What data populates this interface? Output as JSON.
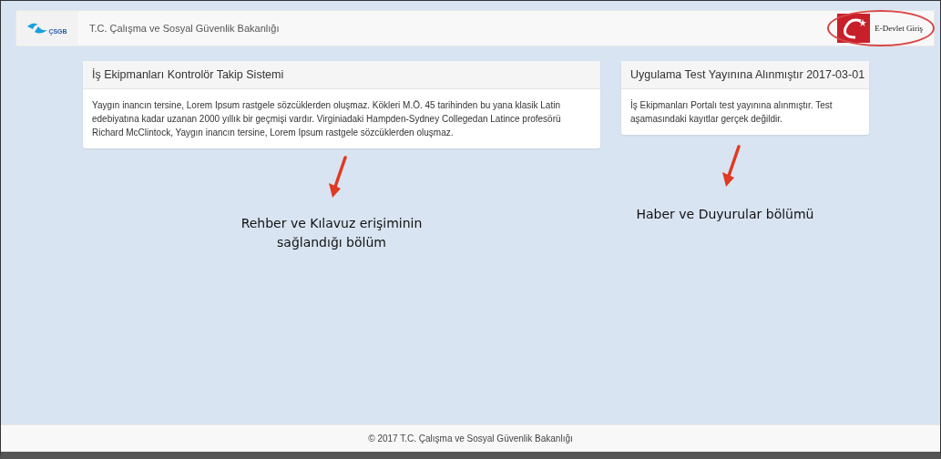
{
  "navbar": {
    "logo_text": "ÇSGB",
    "title": "T.C. Çalışma ve Sosyal Güvenlik Bakanlığı",
    "login": {
      "label": "E-Devlet Giriş",
      "highlighted": true
    }
  },
  "panels": [
    {
      "title": "İş Ekipmanları Kontrolör Takip Sistemi",
      "body": "Yaygın inancın tersine, Lorem Ipsum rastgele sözcüklerden oluşmaz. Kökleri M.Ö. 45 tarihinden bu yana klasik Latin edebiyatına kadar uzanan 2000 yıllık bir geçmişi vardır. Virginiadaki Hampden-Sydney Collegedan Latince profesörü Richard McClintock, Yaygın inancın tersine, Lorem Ipsum rastgele sözcüklerden oluşmaz."
    },
    {
      "title": "Uygulama Test Yayınına Alınmıştır 2017-03-01",
      "body": "İş Ekipmanları Portalı test yayınına alınmıştır. Test aşamasındaki kayıtlar gerçek değildir."
    }
  ],
  "annotations": [
    {
      "text": "Rehber ve Kılavuz erişiminin sağlandığı bölüm"
    },
    {
      "text": "Haber ve Duyurular bölümü"
    }
  ],
  "footer": "© 2017 T.C. Çalışma ve Sosyal Güvenlik Bakanlığı"
}
